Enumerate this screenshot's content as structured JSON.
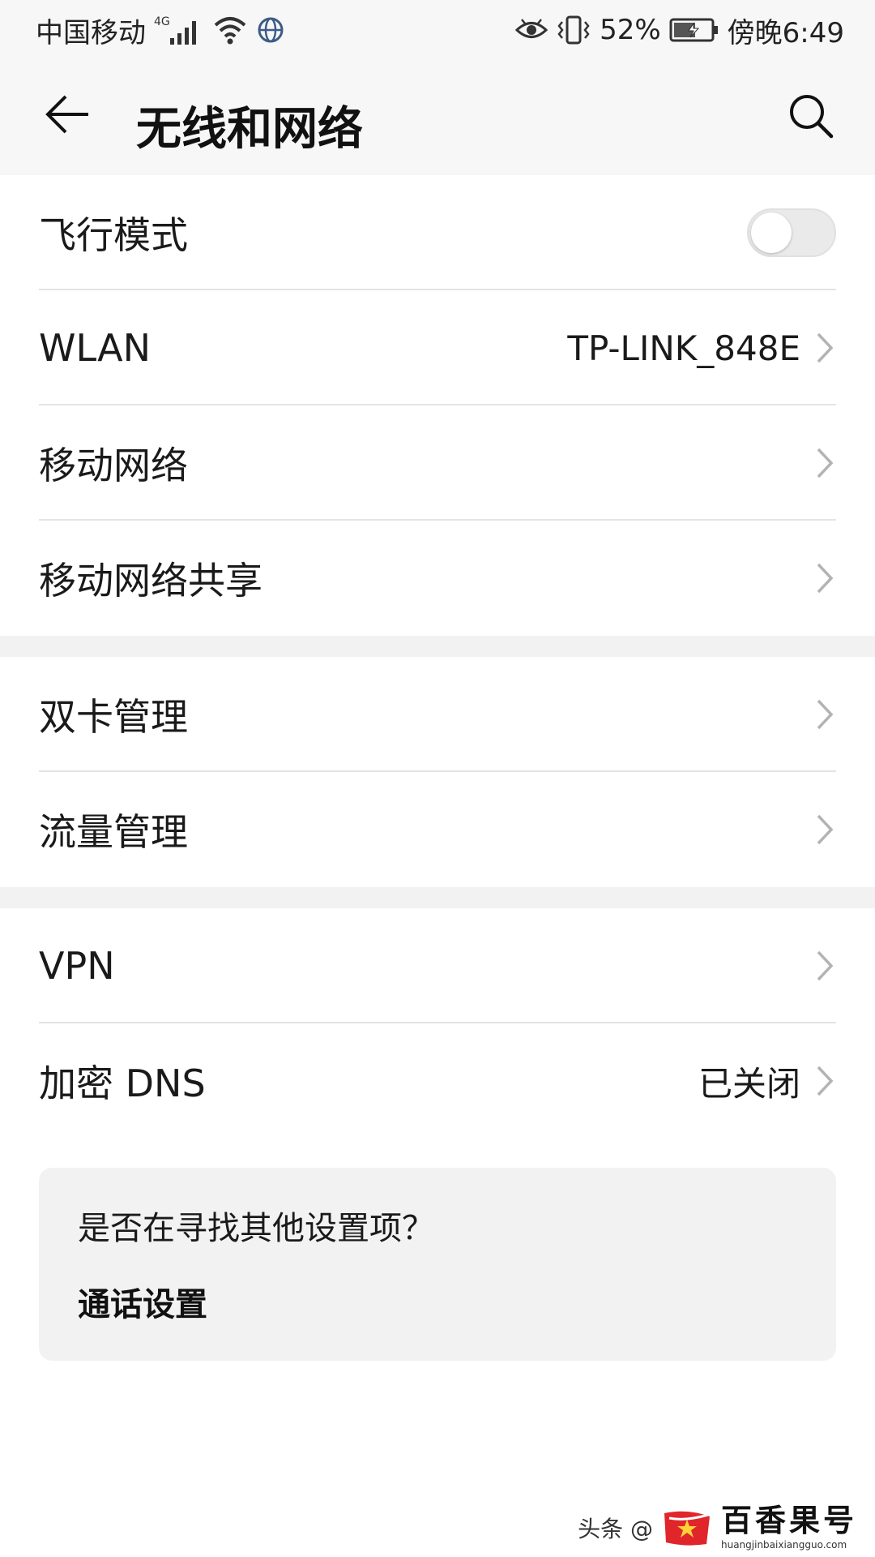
{
  "status_bar": {
    "carrier": "中国移动",
    "network_type": "4G",
    "battery_percent": "52%",
    "time": "傍晚6:49",
    "icons": [
      "signal-icon",
      "wifi-icon",
      "globe-icon",
      "eye-icon",
      "vibrate-icon",
      "battery-icon"
    ]
  },
  "header": {
    "title": "无线和网络",
    "back_icon": "back-arrow-icon",
    "search_icon": "search-icon"
  },
  "groups": [
    {
      "rows": [
        {
          "id": "airplane",
          "label": "飞行模式",
          "type": "toggle",
          "toggle_on": false
        },
        {
          "id": "wlan",
          "label": "WLAN",
          "value": "TP-LINK_848E",
          "type": "chevron"
        },
        {
          "id": "mobile-network",
          "label": "移动网络",
          "type": "chevron"
        },
        {
          "id": "tethering",
          "label": "移动网络共享",
          "type": "chevron"
        }
      ]
    },
    {
      "rows": [
        {
          "id": "dual-sim",
          "label": "双卡管理",
          "type": "chevron"
        },
        {
          "id": "data-usage",
          "label": "流量管理",
          "type": "chevron"
        }
      ]
    },
    {
      "rows": [
        {
          "id": "vpn",
          "label": "VPN",
          "type": "chevron"
        },
        {
          "id": "private-dns",
          "label": "加密 DNS",
          "value": "已关闭",
          "type": "chevron"
        }
      ]
    }
  ],
  "suggestion": {
    "title": "是否在寻找其他设置项？",
    "link": "通话设置"
  },
  "watermark": {
    "prefix": "头条 @",
    "brand": "百香果号",
    "url": "huangjinbaixiangguo.com"
  },
  "colors": {
    "header_bg": "#f7f7f7",
    "group_gap": "#f2f2f2",
    "divider": "#e4e4e4",
    "chevron": "#b3b3b3",
    "card_bg": "#f2f2f2",
    "logo_red": "#e0262b"
  }
}
